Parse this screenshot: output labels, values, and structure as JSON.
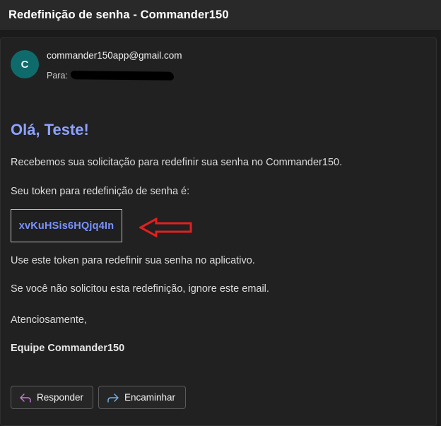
{
  "window": {
    "title": "Redefinição de senha - Commander150"
  },
  "message": {
    "avatar_initial": "C",
    "sender": "commander150app@gmail.com",
    "to_label": "Para:",
    "greeting": "Olá, Teste!",
    "paragraph_1": "Recebemos sua solicitação para redefinir sua senha no Commander150.",
    "paragraph_2": "Seu token para redefinição de senha é:",
    "token": "xvKuHSis6HQjq4In",
    "paragraph_3": "Use este token para redefinir sua senha no aplicativo.",
    "paragraph_4": "Se você não solicitou esta redefinição, ignore este email.",
    "closing": "Atenciosamente,",
    "signature": "Equipe Commander150"
  },
  "actions": {
    "reply_label": "Responder",
    "forward_label": "Encaminhar",
    "reply_icon": "reply-arrow-icon",
    "forward_icon": "forward-arrow-icon"
  },
  "colors": {
    "accent": "#8da2ff",
    "token_text": "#7b93ff",
    "avatar_bg": "#0f6b6b",
    "annotation_arrow": "#e02020",
    "reply_icon": "#c77bd6",
    "forward_icon": "#6fb4f0"
  }
}
